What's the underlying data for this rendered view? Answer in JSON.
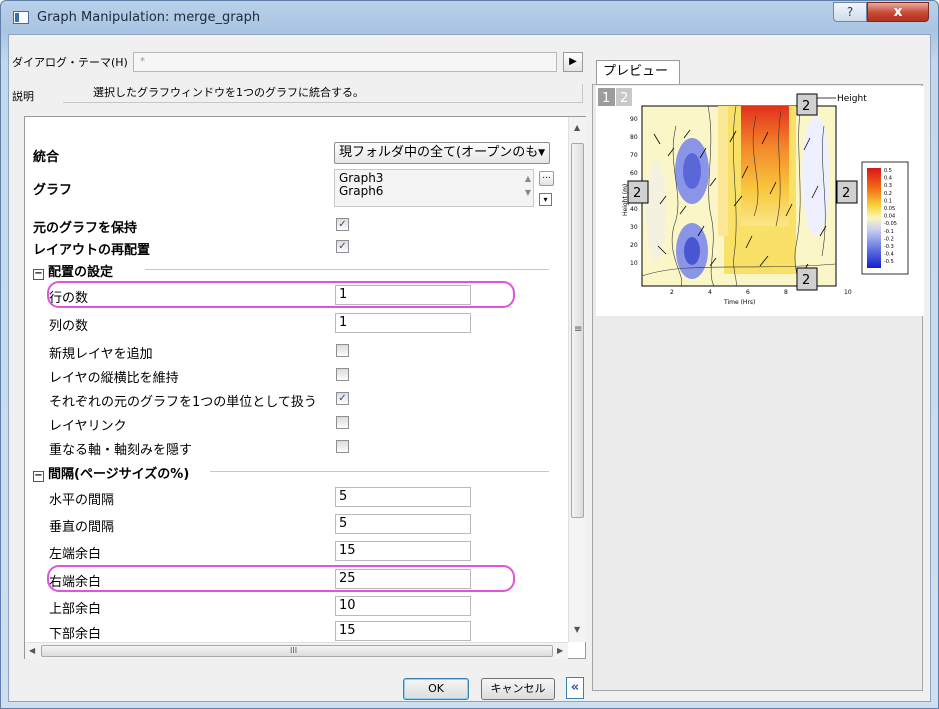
{
  "window": {
    "title": "Graph Manipulation: merge_graph",
    "help_glyph": "?",
    "close_glyph": "x"
  },
  "theme": {
    "label": "ダイアログ・テーマ(H)",
    "value": "*",
    "arrow_glyph": "▶"
  },
  "description": {
    "label": "説明",
    "text": "選択したグラフウィンドウを1つのグラフに統合する。"
  },
  "merge": {
    "label": "統合",
    "value": "現フォルダ中の全て(オープンのも",
    "caret": "▼"
  },
  "graphs": {
    "label": "グラフ",
    "items": [
      "Graph3",
      "Graph6"
    ],
    "dots": "...",
    "expand": "▾"
  },
  "keep_source": {
    "label": "元のグラフを保持",
    "checked": true
  },
  "rearrange": {
    "label": "レイアウトの再配置",
    "checked": true
  },
  "arrange": {
    "header": "配置の設定",
    "collapse_glyph": "−",
    "rows": {
      "label": "行の数",
      "value": "1"
    },
    "cols": {
      "label": "列の数",
      "value": "1"
    },
    "add_layer": {
      "label": "新規レイヤを追加",
      "checked": false
    },
    "keep_ratio": {
      "label": "レイヤの縦横比を維持",
      "checked": false
    },
    "treat_unit": {
      "label": "それぞれの元のグラフを1つの単位として扱う",
      "checked": true
    },
    "layer_link": {
      "label": "レイヤリンク",
      "checked": false
    },
    "hide_axes": {
      "label": "重なる軸・軸刻みを隠す",
      "checked": false
    }
  },
  "spacing": {
    "header": "間隔(ページサイズの%)",
    "collapse_glyph": "−",
    "h_gap": {
      "label": "水平の間隔",
      "value": "5"
    },
    "v_gap": {
      "label": "垂直の間隔",
      "value": "5"
    },
    "left": {
      "label": "左端余白",
      "value": "15"
    },
    "right": {
      "label": "右端余白",
      "value": "25"
    },
    "top": {
      "label": "上部余白",
      "value": "10"
    },
    "bottom": {
      "label": "下部余白",
      "value": "15"
    }
  },
  "scroll": {
    "up": "▲",
    "down": "▼",
    "left": "◀",
    "right": "▶",
    "grip": "≡",
    "hgrip": "III"
  },
  "buttons": {
    "ok": "OK",
    "cancel": "キャンセル",
    "collapse": "«"
  },
  "preview": {
    "tab": "プレビュー",
    "page_tabs": [
      "1",
      "2"
    ],
    "layer_badge": "2",
    "height_label": "Height",
    "xlabel": "Time (Hrs)",
    "ylabel": "Height (m)",
    "x_ticks": [
      "2",
      "4",
      "6",
      "8",
      "10"
    ],
    "y_ticks": [
      "90",
      "80",
      "70",
      "60",
      "50",
      "40",
      "30",
      "20",
      "10"
    ],
    "legend_values": [
      "0.5",
      "0.4",
      "0.3",
      "0.2",
      "0.1",
      "0.05",
      "0.04",
      "-0.05",
      "-0.1",
      "-0.2",
      "-0.3",
      "-0.4",
      "-0.5"
    ]
  }
}
